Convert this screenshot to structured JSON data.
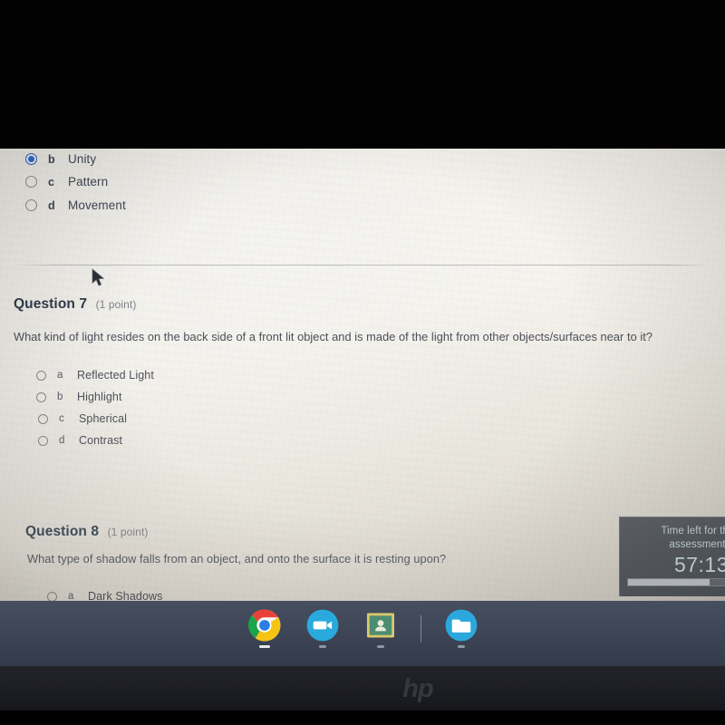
{
  "device": {
    "brand_logo": "hp"
  },
  "assessment": {
    "previous_question": {
      "options": [
        {
          "letter": "b",
          "text": "Unity",
          "selected": true
        },
        {
          "letter": "c",
          "text": "Pattern",
          "selected": false
        },
        {
          "letter": "d",
          "text": "Movement",
          "selected": false
        }
      ]
    },
    "question_7": {
      "title": "Question 7",
      "points": "(1 point)",
      "body": "What kind of light resides on the back side of a front lit object and is made of the light from other objects/surfaces near to it?",
      "options": [
        {
          "letter": "a",
          "text": "Reflected Light",
          "selected": false
        },
        {
          "letter": "b",
          "text": "Highlight",
          "selected": false
        },
        {
          "letter": "c",
          "text": "Spherical",
          "selected": false
        },
        {
          "letter": "d",
          "text": "Contrast",
          "selected": false
        }
      ]
    },
    "question_8": {
      "title": "Question 8",
      "points": "(1 point)",
      "body": "What type of shadow falls from an object, and onto the surface it is resting upon?",
      "options": [
        {
          "letter": "a",
          "text": "Dark Shadows",
          "selected": false
        }
      ]
    }
  },
  "timer": {
    "label_line1": "Time left for th",
    "label_line2": "assessment:",
    "value": "57:13",
    "progress_percent": 78,
    "panel_color": "#4e5258",
    "text_color": "#b9c9c2"
  },
  "shelf": {
    "items": [
      {
        "name": "chrome",
        "label": "Chrome",
        "running": true
      },
      {
        "name": "zoom",
        "label": "Zoom",
        "running": true
      },
      {
        "name": "classroom",
        "label": "Google Classroom",
        "running": false
      },
      {
        "name": "files",
        "label": "Files",
        "running": true
      }
    ]
  }
}
